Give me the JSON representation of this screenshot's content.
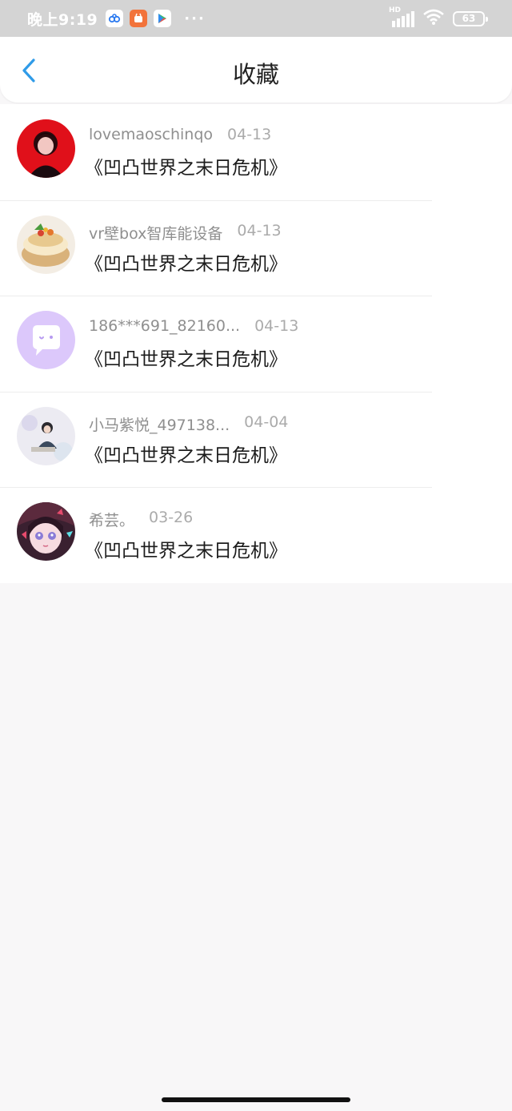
{
  "status_bar": {
    "time": "晚上9:19",
    "more": "···",
    "network": "HD",
    "battery": "63",
    "icons": [
      "baidu-app-icon",
      "taobao-app-icon",
      "play-store-icon",
      "signal-icon",
      "wifi-icon",
      "battery-icon"
    ]
  },
  "header": {
    "title": "收藏",
    "back_icon": "chevron-left-icon",
    "accent": "#2f9be8"
  },
  "favorites": [
    {
      "username": "lovemaoschinqo",
      "date": "04-13",
      "title": "《凹凸世界之末日危机》",
      "avatar": "red-anime-boy-avatar"
    },
    {
      "username": "vr壁box智库能设备",
      "date": "04-13",
      "title": "《凹凸世界之末日危机》",
      "avatar": "cake-avatar"
    },
    {
      "username": "186***691_82160...",
      "date": "04-13",
      "title": "《凹凸世界之末日危机》",
      "avatar": "default-chat-avatar"
    },
    {
      "username": "小马紫悦_497138...",
      "date": "04-04",
      "title": "《凹凸世界之末日危机》",
      "avatar": "girl-photo-avatar"
    },
    {
      "username": "希芸。",
      "date": "03-26",
      "title": "《凹凸世界之末日危机》",
      "avatar": "anime-girl-avatar"
    }
  ]
}
